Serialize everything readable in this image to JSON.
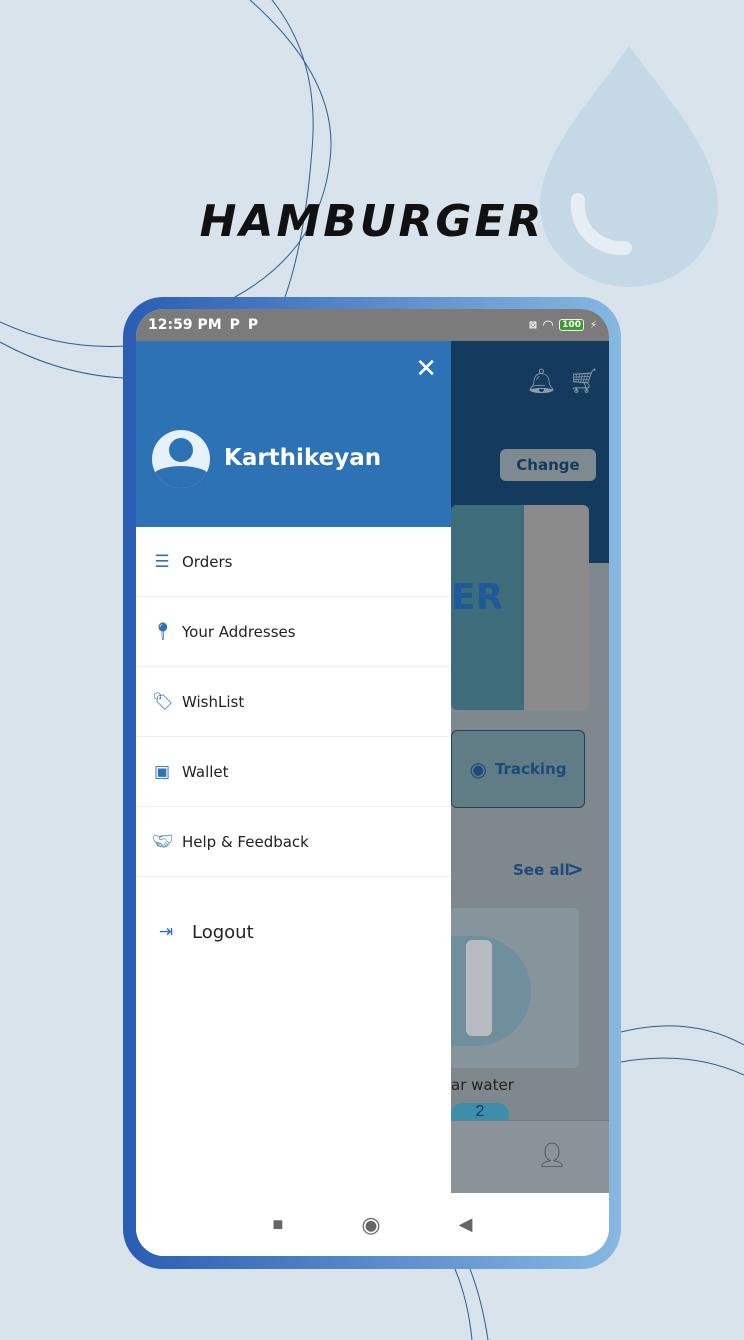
{
  "heading": "HAMBURGER",
  "status_bar": {
    "time": "12:59 PM",
    "notif1": "P",
    "notif2": "P",
    "battery": "100"
  },
  "drawer": {
    "user_name": "Karthikeyan",
    "items": [
      {
        "label": "Orders",
        "icon": "list-icon"
      },
      {
        "label": "Your Addresses",
        "icon": "map-pin-icon"
      },
      {
        "label": "WishList",
        "icon": "tag-icon"
      },
      {
        "label": "Wallet",
        "icon": "wallet-icon"
      },
      {
        "label": "Help & Feedback",
        "icon": "handshake-icon"
      }
    ],
    "logout": "Logout"
  },
  "background_app": {
    "change_button": "Change",
    "banner_text": "ER",
    "tracking": "Tracking",
    "see_all": "See all",
    "product_name": "ar water",
    "qty": "2"
  },
  "colors": {
    "accent": "#2d72b5",
    "background": "#d9e3ec"
  }
}
